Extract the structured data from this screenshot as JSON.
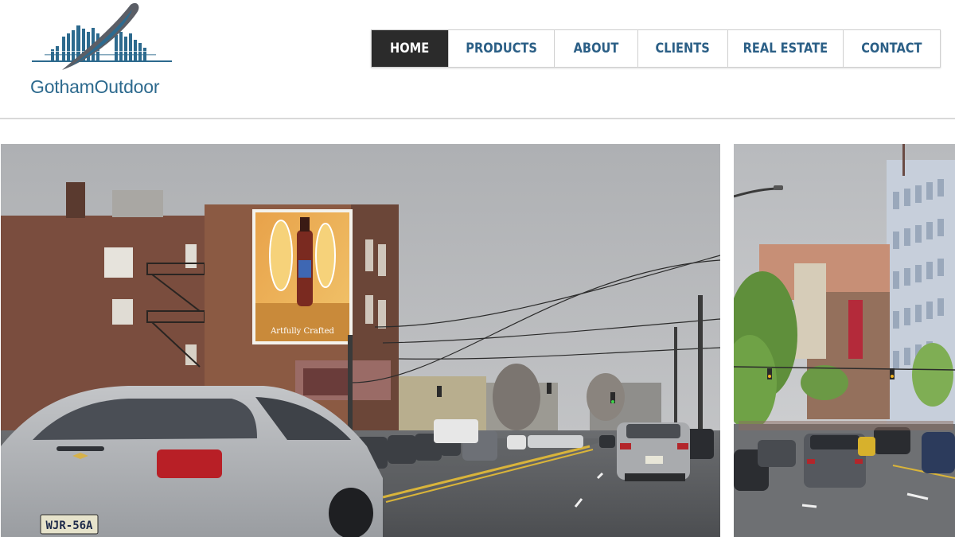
{
  "site": {
    "logo_text": "GothamOutdoor",
    "brand_color": "#2d6a8e"
  },
  "nav": {
    "items": [
      {
        "label": "HOME",
        "active": true
      },
      {
        "label": "PRODUCTS",
        "active": false
      },
      {
        "label": "ABOUT",
        "active": false
      },
      {
        "label": "CLIENTS",
        "active": false
      },
      {
        "label": "REAL ESTATE",
        "active": false
      },
      {
        "label": "CONTACT",
        "active": false
      }
    ],
    "active_bg": "#2b2b2b",
    "text_color": "#2b5f86"
  },
  "photos": {
    "main": {
      "billboard_text": "Artfully Crafted",
      "plate_text": "WJR-56A"
    },
    "side": {}
  }
}
